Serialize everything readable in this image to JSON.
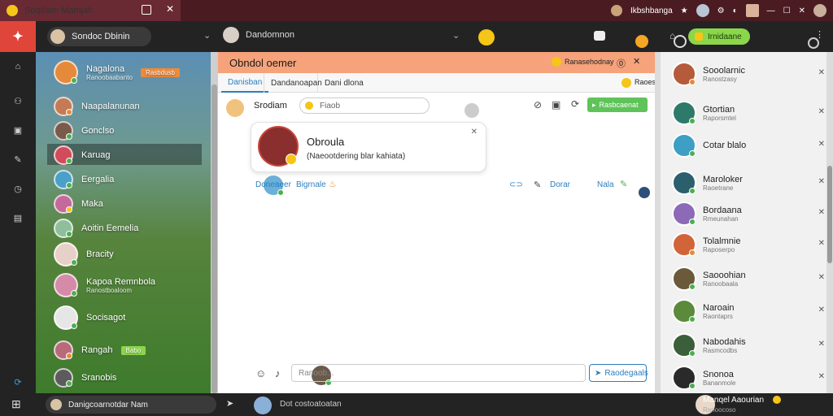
{
  "titlebar": {
    "tab_title": "Soqiliam Mamjah",
    "profile_name": "Ikbshbanga",
    "controls": [
      "—",
      "☐",
      "✕"
    ]
  },
  "topbar": {
    "account_name": "Sondoc Dbinin",
    "contact_name": "Dandomnon",
    "action_button": "Irnidaane"
  },
  "contacts": [
    {
      "name": "Nagalona",
      "sub": "Ranoobaabanto",
      "tag": "Rasbdusb",
      "color": "#e58a3a",
      "status": "#4caf50"
    },
    {
      "name": "Naapalanunan",
      "sub": "",
      "tag": "",
      "color": "#c47b55",
      "status": "#e58a3a"
    },
    {
      "name": "Gonclso",
      "sub": "",
      "tag": "",
      "color": "#7a5a4a",
      "status": "#4caf50"
    },
    {
      "name": "Karuag",
      "sub": "",
      "tag": "",
      "color": "#d24b5a",
      "status": "#4caf50"
    },
    {
      "name": "Eergalia",
      "sub": "",
      "tag": "",
      "color": "#4aa0c8",
      "status": "#4caf50"
    },
    {
      "name": "Maka",
      "sub": "",
      "tag": "",
      "color": "#c46a9a",
      "status": "#f5c518"
    },
    {
      "name": "Aoitin Eemelia",
      "sub": "",
      "tag": "",
      "color": "#8fbf9a",
      "status": "#4caf50"
    },
    {
      "name": "Bracity",
      "sub": "",
      "tag": "",
      "color": "#e7d0c8",
      "status": "#4caf50"
    },
    {
      "name": "Kapoa Remnbola",
      "sub": "Ranostboaloom",
      "tag": "",
      "color": "#d58aa8",
      "status": "#4caf50"
    },
    {
      "name": "Socisagot",
      "sub": "",
      "tag": "",
      "color": "#e6e6e6",
      "status": "#4caf50"
    },
    {
      "name": "Rangah",
      "sub": "",
      "tag": "Babo",
      "color": "#b86a7a",
      "status": "#e58a3a"
    },
    {
      "name": "Sranobis",
      "sub": "",
      "tag": "",
      "color": "#5c5c5c",
      "status": "#4caf50"
    }
  ],
  "chat": {
    "header_title": "Obndol oemer",
    "header_right": "Ranasehodnay",
    "tabs": [
      "Danisban",
      "Dandanoapan",
      "Dani dlona"
    ],
    "right_status": "Raoes",
    "compose_name": "Srodiam",
    "compose_input": "Fiaob",
    "compose_send": "Rasbcaenat",
    "card_title": "Obroula",
    "card_text": "(Naeootdering blar kahiata)",
    "reaction_name": "Doneaeer",
    "reaction_label": "Bigrnale",
    "reaction_actions": [
      "Dorar",
      "Nala"
    ],
    "input_placeholder": "Ranoob...",
    "input_button": "Raodegaals"
  },
  "people": [
    {
      "name": "Sooolarnic",
      "sub": "Ranostzasy",
      "color": "#b55a3a",
      "status": "#e58a3a"
    },
    {
      "name": "Gtortian",
      "sub": "Raporsmtel",
      "color": "#2e7a6a",
      "status": "#4caf50"
    },
    {
      "name": "Cotar blalo",
      "sub": "",
      "color": "#3d9fc4",
      "status": "#4caf50"
    },
    {
      "name": "Maroloker",
      "sub": "Raoetrane",
      "color": "#2b5f6e",
      "status": "#4caf50"
    },
    {
      "name": "Bordaana",
      "sub": "Rmeunahan",
      "color": "#8c6ab8",
      "status": "#4caf50"
    },
    {
      "name": "Tolalmnie",
      "sub": "Raposerpo",
      "color": "#d2643a",
      "status": "#e58a3a"
    },
    {
      "name": "Saooohian",
      "sub": "Ranoobaala",
      "color": "#6a5a3a",
      "status": "#4caf50"
    },
    {
      "name": "Naroain",
      "sub": "Raontaprs",
      "color": "#5a8a3a",
      "status": "#4caf50"
    },
    {
      "name": "Nabodahis",
      "sub": "Rasmcodbs",
      "color": "#3a5f3a",
      "status": "#4caf50"
    },
    {
      "name": "Snonoa",
      "sub": "Bananmole",
      "color": "#2a2a2a",
      "status": "#4caf50"
    }
  ],
  "bottombar": {
    "search_text": "Danigcoarnotdar Nam",
    "contact_text": "Dot costoatoatan",
    "profile_name": "Manqel Aaourian",
    "profile_sub": "Ranoocoso"
  }
}
